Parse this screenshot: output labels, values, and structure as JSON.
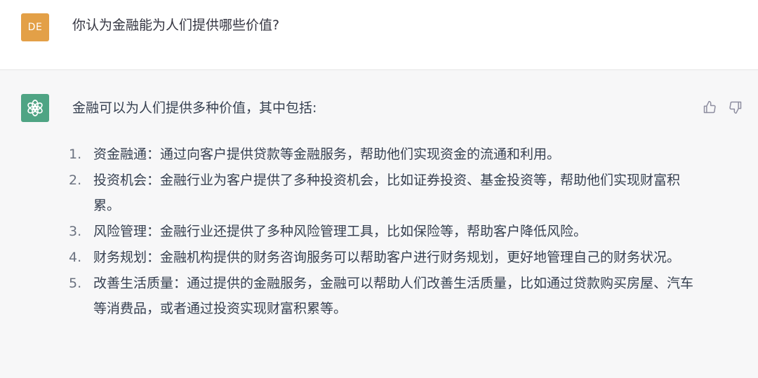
{
  "user": {
    "avatar_text": "DE",
    "message": "你认为金融能为人们提供哪些价值?"
  },
  "assistant": {
    "avatar_icon": "openai-logo-icon",
    "intro": "金融可以为人们提供多种价值，其中包括:",
    "items": [
      {
        "num": "1.",
        "text": "资金融通：通过向客户提供贷款等金融服务，帮助他们实现资金的流通和利用。"
      },
      {
        "num": "2.",
        "text": "投资机会：金融行业为客户提供了多种投资机会，比如证券投资、基金投资等，帮助他们实现财富积累。"
      },
      {
        "num": "3.",
        "text": "风险管理：金融行业还提供了多种风险管理工具，比如保险等，帮助客户降低风险。"
      },
      {
        "num": "4.",
        "text": "财务规划：金融机构提供的财务咨询服务可以帮助客户进行财务规划，更好地管理自己的财务状况。"
      },
      {
        "num": "5.",
        "text": "改善生活质量：通过提供的金融服务，金融可以帮助人们改善生活质量，比如通过贷款购买房屋、汽车等消费品，或者通过投资实现财富积累等。"
      }
    ]
  },
  "colors": {
    "user_avatar": "#e3a047",
    "bot_avatar": "#4fa484",
    "assistant_bg": "#f7f7f8"
  }
}
